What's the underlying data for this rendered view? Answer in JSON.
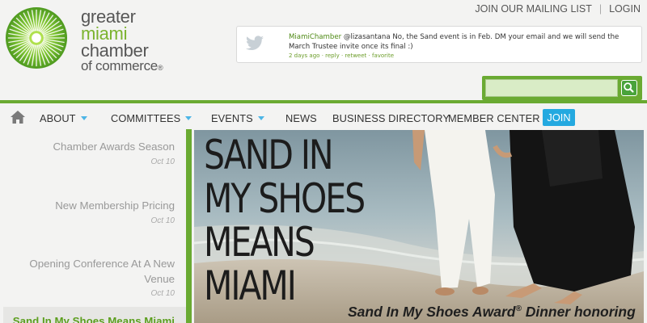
{
  "logo": {
    "line1": "greater",
    "line2": "miami",
    "line3": "chamber",
    "line4": "of commerce",
    "trademark": "®",
    "brand_green": "#7bb32e"
  },
  "top_links": {
    "mailing_list": "JOIN OUR MAILING LIST",
    "separator": "|",
    "login": "LOGIN"
  },
  "tweet": {
    "icon": "twitter-bird-icon",
    "user": "MiamiChamber",
    "text": "@lizasantana No, the Sand event is in Feb. DM your email and we will send the March Trustee invite once its final :)",
    "time": "2 days ago",
    "dot": "·",
    "reply": "reply",
    "retweet": "retweet",
    "favorite": "favorite"
  },
  "search": {
    "placeholder": "",
    "value": "",
    "icon": "search-icon"
  },
  "nav": {
    "home_icon": "home-icon",
    "items": [
      "ABOUT",
      "COMMITTEES",
      "EVENTS",
      "NEWS",
      "BUSINESS DIRECTORY",
      "MEMBER CENTER"
    ],
    "join": "JOIN",
    "accent": "#24a9e0"
  },
  "sidebar": {
    "items": [
      {
        "title": "Chamber Awards Season",
        "date": "Oct 10"
      },
      {
        "title": "New Membership Pricing",
        "date": "Oct 10"
      },
      {
        "title": "Opening Conference At A New Venue",
        "title_line1": "Opening Conference At A New",
        "title_line2": "Venue",
        "date": "Oct 10"
      }
    ],
    "active": {
      "title": "Sand In My Shoes Means Miami"
    }
  },
  "hero": {
    "title_lines": [
      "SAND IN",
      "MY SHOES",
      "MEANS",
      "MIAMI"
    ],
    "caption_pre": "Sand In My Shoes Award",
    "caption_reg": "®",
    "caption_post": " Dinner honoring"
  },
  "colors": {
    "green": "#6aaa32",
    "background": "#f3f3f2",
    "join_blue": "#24a9e0"
  }
}
